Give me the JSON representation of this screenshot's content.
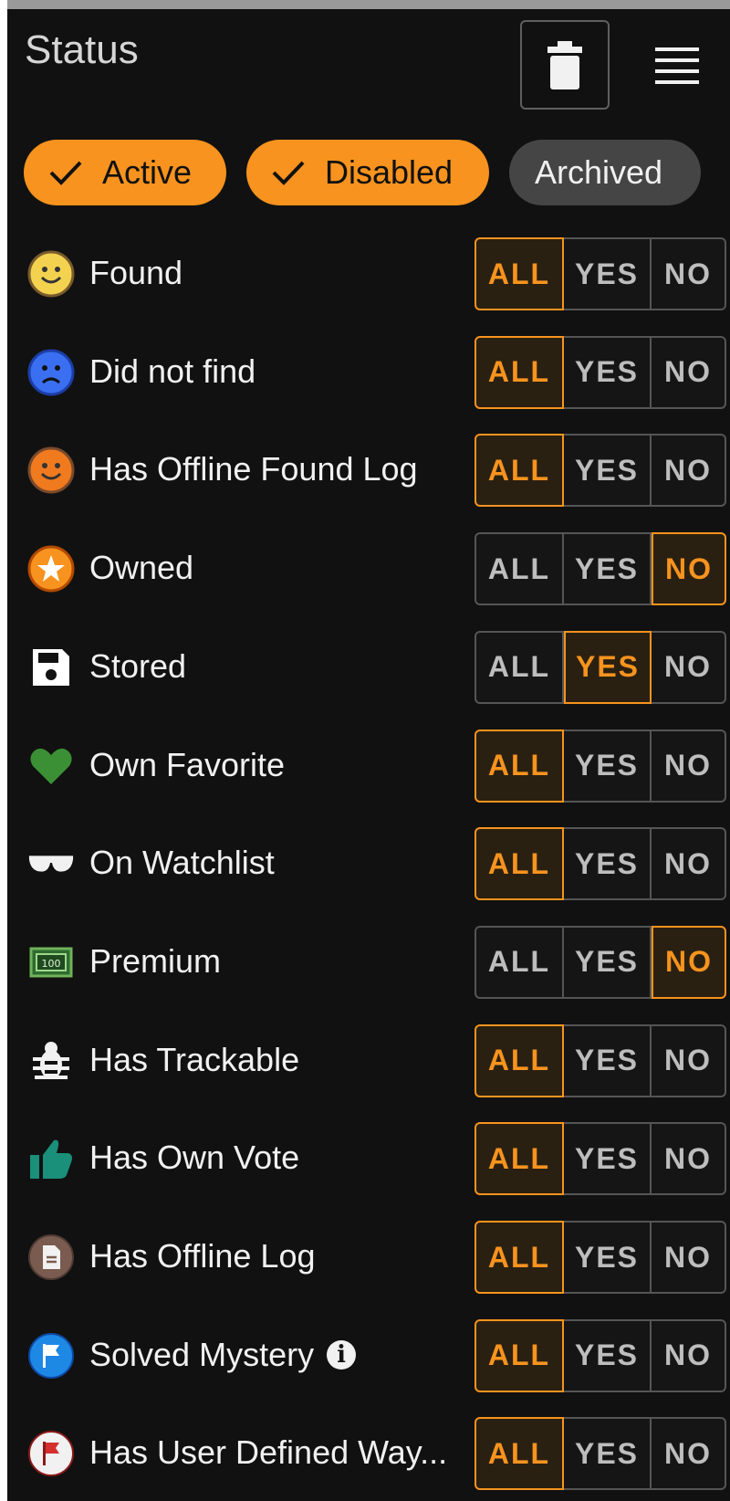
{
  "header": {
    "title": "Status",
    "trash_icon": "trash-icon",
    "menu_icon": "menu-icon"
  },
  "chips": [
    {
      "label": "Active",
      "selected": true
    },
    {
      "label": "Disabled",
      "selected": true
    },
    {
      "label": "Archived",
      "selected": false
    }
  ],
  "toggle_labels": {
    "all": "ALL",
    "yes": "YES",
    "no": "NO"
  },
  "filters": [
    {
      "label": "Found",
      "icon": "smile-icon",
      "value": "all"
    },
    {
      "label": "Did not find",
      "icon": "sad-icon",
      "value": "all"
    },
    {
      "label": "Has Offline Found Log",
      "icon": "smile-orange-icon",
      "value": "all"
    },
    {
      "label": "Owned",
      "icon": "star-icon",
      "value": "no"
    },
    {
      "label": "Stored",
      "icon": "floppy-icon",
      "value": "yes"
    },
    {
      "label": "Own Favorite",
      "icon": "heart-icon",
      "value": "all"
    },
    {
      "label": "On Watchlist",
      "icon": "glasses-icon",
      "value": "all"
    },
    {
      "label": "Premium",
      "icon": "banknote-icon",
      "value": "no"
    },
    {
      "label": "Has Trackable",
      "icon": "bug-icon",
      "value": "all"
    },
    {
      "label": "Has Own Vote",
      "icon": "thumbs-up-icon",
      "value": "all"
    },
    {
      "label": "Has Offline Log",
      "icon": "document-icon",
      "value": "all"
    },
    {
      "label": "Solved Mystery",
      "icon": "flag-blue-icon",
      "value": "all",
      "info": true
    },
    {
      "label": "Has User Defined Way...",
      "icon": "flag-red-icon",
      "value": "all"
    }
  ],
  "colors": {
    "accent": "#f7931e",
    "background": "#111111",
    "chip_inactive": "#454545"
  }
}
